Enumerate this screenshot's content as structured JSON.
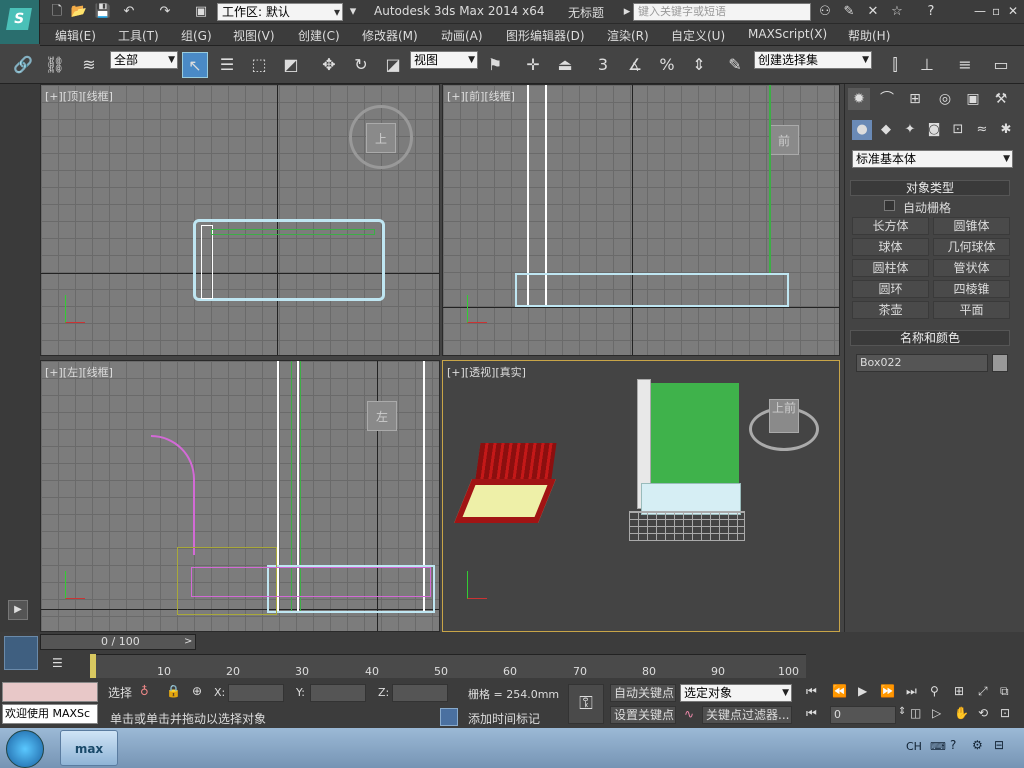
{
  "titlebar": {
    "workspace": "工作区: 默认",
    "app_title": "Autodesk 3ds Max  2014 x64",
    "doc_title": "无标题",
    "search_placeholder": "键入关键字或短语"
  },
  "menu": [
    "编辑(E)",
    "工具(T)",
    "组(G)",
    "视图(V)",
    "创建(C)",
    "修改器(M)",
    "动画(A)",
    "图形编辑器(D)",
    "渲染(R)",
    "自定义(U)",
    "MAXScript(X)",
    "帮助(H)"
  ],
  "toolbar": {
    "selection_filter": "全部",
    "ref_coord": "视图",
    "snap_count": "3",
    "named_selection": "创建选择集"
  },
  "viewports": {
    "top": {
      "label": "[+][顶][线框]",
      "cube": "上"
    },
    "front": {
      "label": "[+][前][线框]",
      "cube": "前"
    },
    "left": {
      "label": "[+][左][线框]",
      "cube": "左"
    },
    "persp": {
      "label": "[+][透视][真实]",
      "cube": "上前"
    }
  },
  "command_panel": {
    "category": "标准基本体",
    "object_type_title": "对象类型",
    "autogrid": "自动栅格",
    "buttons": [
      "长方体",
      "圆锥体",
      "球体",
      "几何球体",
      "圆柱体",
      "管状体",
      "圆环",
      "四棱锥",
      "茶壶",
      "平面"
    ],
    "name_color_title": "名称和颜色",
    "object_name": "Box022"
  },
  "timeline": {
    "frame_display": "0 / 100",
    "ticks": [
      "10",
      "20",
      "30",
      "40",
      "50",
      "60",
      "70",
      "80",
      "90",
      "100"
    ]
  },
  "status": {
    "maxscript_text": "欢迎使用 MAXSc",
    "selected_label": "选择",
    "x_label": "X:",
    "y_label": "Y:",
    "z_label": "Z:",
    "grid": "栅格 = 254.0mm",
    "prompt": "单击或单击并拖动以选择对象",
    "add_time_tag": "添加时间标记",
    "auto_key": "自动关键点",
    "set_key": "设置关键点",
    "key_mode": "选定对象",
    "key_filters": "关键点过滤器...",
    "frame": "0"
  },
  "taskbar": {
    "lang": "CH",
    "app_label": "max"
  }
}
